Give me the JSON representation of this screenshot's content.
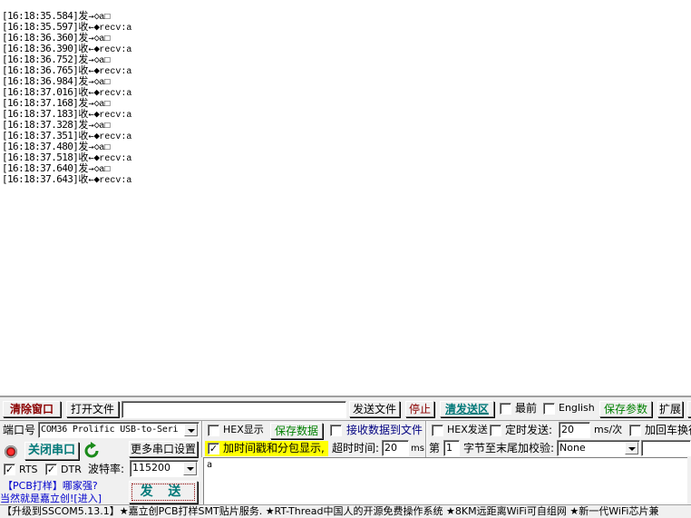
{
  "log": {
    "lines": [
      {
        "time": "[16:18:35.584]",
        "dir": "发",
        "arrow": "→",
        "marker": "◇",
        "payload": "a□"
      },
      {
        "time": "[16:18:35.597]",
        "dir": "收",
        "arrow": "←",
        "marker": "◆",
        "payload": "recv:a"
      },
      {
        "time": "[16:18:36.360]",
        "dir": "发",
        "arrow": "→",
        "marker": "◇",
        "payload": "a□"
      },
      {
        "time": "[16:18:36.390]",
        "dir": "收",
        "arrow": "←",
        "marker": "◆",
        "payload": "recv:a"
      },
      {
        "time": "[16:18:36.752]",
        "dir": "发",
        "arrow": "→",
        "marker": "◇",
        "payload": "a□"
      },
      {
        "time": "[16:18:36.765]",
        "dir": "收",
        "arrow": "←",
        "marker": "◆",
        "payload": "recv:a"
      },
      {
        "time": "[16:18:36.984]",
        "dir": "发",
        "arrow": "→",
        "marker": "◇",
        "payload": "a□"
      },
      {
        "time": "[16:18:37.016]",
        "dir": "收",
        "arrow": "←",
        "marker": "◆",
        "payload": "recv:a"
      },
      {
        "time": "[16:18:37.168]",
        "dir": "发",
        "arrow": "→",
        "marker": "◇",
        "payload": "a□"
      },
      {
        "time": "[16:18:37.183]",
        "dir": "收",
        "arrow": "←",
        "marker": "◆",
        "payload": "recv:a"
      },
      {
        "time": "[16:18:37.328]",
        "dir": "发",
        "arrow": "→",
        "marker": "◇",
        "payload": "a□"
      },
      {
        "time": "[16:18:37.351]",
        "dir": "收",
        "arrow": "←",
        "marker": "◆",
        "payload": "recv:a"
      },
      {
        "time": "[16:18:37.480]",
        "dir": "发",
        "arrow": "→",
        "marker": "◇",
        "payload": "a□"
      },
      {
        "time": "[16:18:37.518]",
        "dir": "收",
        "arrow": "←",
        "marker": "◆",
        "payload": "recv:a"
      },
      {
        "time": "[16:18:37.640]",
        "dir": "发",
        "arrow": "→",
        "marker": "◇",
        "payload": "a□"
      },
      {
        "time": "[16:18:37.643]",
        "dir": "收",
        "arrow": "←",
        "marker": "◆",
        "payload": "recv:a"
      }
    ]
  },
  "toolbar": {
    "clear_window": "清除窗口",
    "open_file": "打开文件",
    "file_path": "",
    "send_file": "发送文件",
    "stop": "停止",
    "clear_send": "清发送区",
    "topmost_label": "最前",
    "topmost_checked": false,
    "english_label": "English",
    "english_checked": false,
    "save_params": "保存参数",
    "expand": "扩展"
  },
  "port": {
    "label": "端口号",
    "value": "COM36 Prolific USB-to-Seri",
    "close_port": "关闭串口",
    "more_settings": "更多串口设置",
    "rts_label": "RTS",
    "rts_checked": true,
    "dtr_label": "DTR",
    "dtr_checked": true,
    "baud_label": "波特率:",
    "baud_value": "115200"
  },
  "receive_opts": {
    "hex_display": "HEX显示",
    "hex_display_checked": false,
    "save_data": "保存数据",
    "recv_to_file": "接收数据到文件",
    "recv_to_file_checked": false,
    "timestamp": "加时间戳和分包显示,",
    "timestamp_checked": true,
    "timeout_label": "超时时间:",
    "timeout_value": "20",
    "timeout_unit": "ms"
  },
  "send_opts": {
    "hex_send": "HEX发送",
    "hex_send_checked": false,
    "timed_send": "定时发送:",
    "timed_send_checked": false,
    "interval_value": "20",
    "interval_unit": "ms/次",
    "add_crlf": "加回车换行",
    "add_crlf_checked": false,
    "byte_prefix": "第",
    "byte_index": "1",
    "checksum_label": "字节至末尾加校验:",
    "checksum_value": "None",
    "checksum_extra": ""
  },
  "send": {
    "text": "a",
    "button": "发 送"
  },
  "promo": {
    "line1": "【PCB打样】哪家强?",
    "line2": "当然就是嘉立创![进入]"
  },
  "status_bar": {
    "text": "【升级到SSCOM5.13.1】★嘉立创PCB打样SMT贴片服务. ★RT-Thread中国人的开源免费操作系统 ★8KM远距离WiFi可自组网 ★新一代WiFi芯片兼"
  },
  "colors": {
    "panel_bg": "#f0f0f0",
    "timestamp_highlight": "#ffff00",
    "accent_red": "#8b0000",
    "accent_green": "#008000",
    "accent_teal": "#007878",
    "link_blue": "#0000cc"
  }
}
